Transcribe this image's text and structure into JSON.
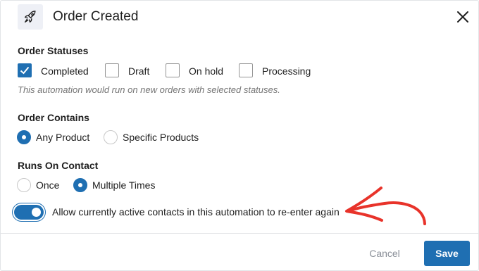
{
  "dialog": {
    "title": "Order Created",
    "icon": "rocket-icon",
    "close_icon": "close-icon"
  },
  "order_statuses": {
    "label": "Order Statuses",
    "options": [
      {
        "label": "Completed",
        "checked": true
      },
      {
        "label": "Draft",
        "checked": false
      },
      {
        "label": "On hold",
        "checked": false
      },
      {
        "label": "Processing",
        "checked": false
      }
    ],
    "helper": "This automation would run on new orders with selected statuses."
  },
  "order_contains": {
    "label": "Order Contains",
    "options": [
      {
        "label": "Any Product",
        "selected": true
      },
      {
        "label": "Specific Products",
        "selected": false
      }
    ]
  },
  "runs_on_contact": {
    "label": "Runs On Contact",
    "options": [
      {
        "label": "Once",
        "selected": false
      },
      {
        "label": "Multiple Times",
        "selected": true
      }
    ]
  },
  "reenter": {
    "label": "Allow currently active contacts in this automation to re-enter again",
    "enabled": true
  },
  "footer": {
    "cancel_label": "Cancel",
    "save_label": "Save"
  },
  "colors": {
    "accent": "#1f6fb2",
    "annotation_arrow": "#e8332a"
  }
}
